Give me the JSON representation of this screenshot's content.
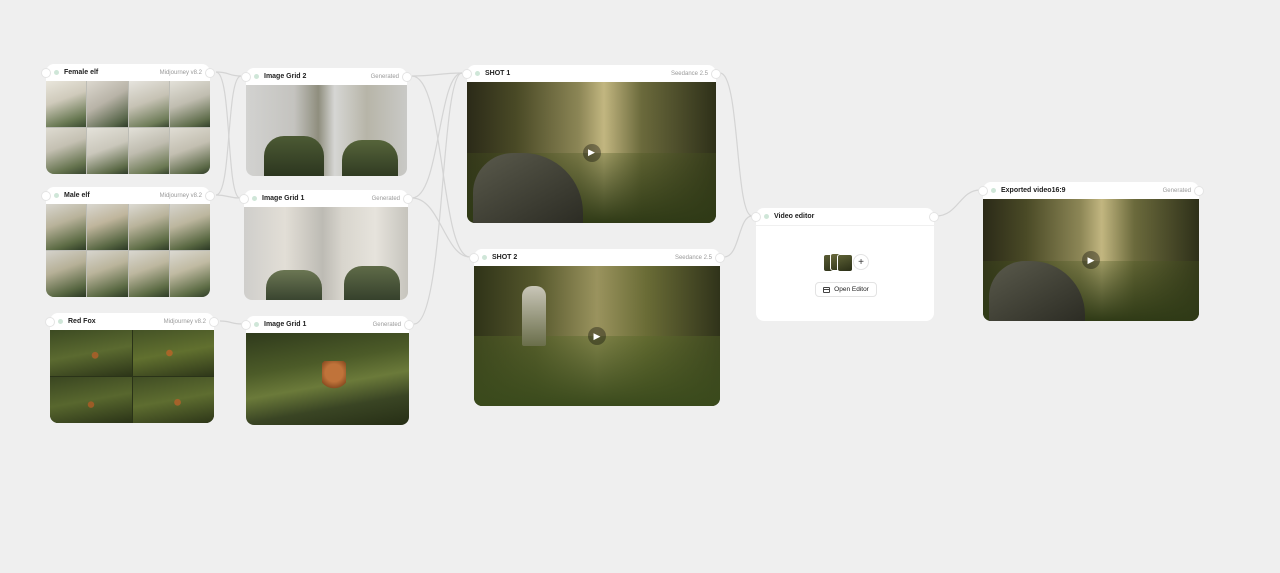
{
  "nodes": {
    "female_elf": {
      "title": "Female elf",
      "tag": "Midjourney v8.2"
    },
    "male_elf": {
      "title": "Male elf",
      "tag": "Midjourney v8.2"
    },
    "red_fox": {
      "title": "Red Fox",
      "tag": "Midjourney v8.2"
    },
    "image_grid_2": {
      "title": "Image Grid 2",
      "tag": "Generated"
    },
    "image_grid_1_elf": {
      "title": "Image Grid 1",
      "tag": "Generated"
    },
    "image_grid_1_fox": {
      "title": "Image Grid 1",
      "tag": "Generated"
    },
    "shot_1": {
      "title": "SHOT 1",
      "tag": "Seedance 2.5"
    },
    "shot_2": {
      "title": "SHOT 2",
      "tag": "Seedance 2.5"
    },
    "video_editor": {
      "title": "Video editor",
      "open_label": "Open Editor",
      "add_glyph": "+"
    },
    "exported": {
      "title": "Exported video16:9",
      "tag": "Generated"
    }
  },
  "icons": {
    "play": "▶",
    "node_dot": "status-dot-icon",
    "editor": "film-icon"
  },
  "colors": {
    "canvas": "#efefef",
    "node": "#ffffff",
    "edge": "#d6d6d6",
    "dot": "#cfe6d8"
  }
}
